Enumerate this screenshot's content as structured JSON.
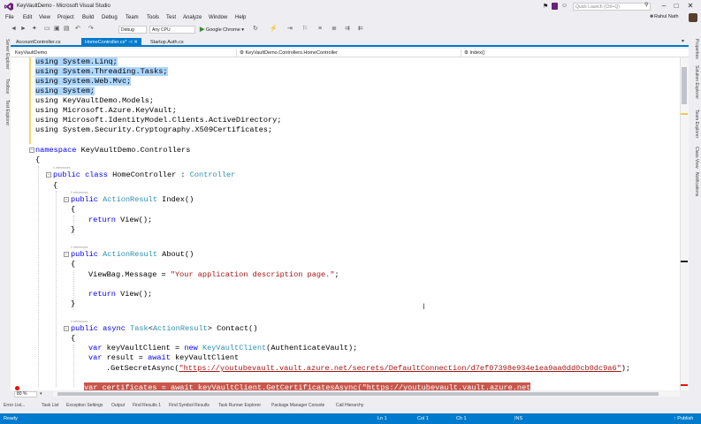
{
  "window": {
    "title": "KeyVaultDemo - Microsoft Visual Studio",
    "quick_launch_placeholder": "Quick Launch (Ctrl+Q)",
    "user_name": "Rahul Nath"
  },
  "menu": [
    "File",
    "Edit",
    "View",
    "Project",
    "Build",
    "Debug",
    "Team",
    "Tools",
    "Test",
    "Analyze",
    "Window",
    "Help"
  ],
  "toolbar": {
    "configuration": "Debug",
    "platform": "Any CPU",
    "run_target": "Google Chrome"
  },
  "left_rail": [
    "Server Explorer",
    "Toolbox",
    "Test Explorer"
  ],
  "right_rail": [
    "Properties",
    "Solution Explorer",
    "Team Explorer",
    "Class View",
    "Notifications"
  ],
  "tabs": [
    {
      "label": "AccountController.cs",
      "active": false
    },
    {
      "label": "HomeController.cs*",
      "active": true
    },
    {
      "label": "Startup.Auth.cs",
      "active": false
    }
  ],
  "navbar": {
    "project": "KeyVaultDemo",
    "class": "KeyVaultDemo.Controllers.HomeController",
    "member": "Index()"
  },
  "code": {
    "using_linq": "using System.Linq;",
    "using_tasks": "using System.Threading.Tasks;",
    "using_mvc": "using System.Web.Mvc;",
    "using_system": "using System;",
    "using_models": "using KeyVaultDemo.Models;",
    "using_keyvault": "using Microsoft.Azure.KeyVault;",
    "using_ad": "using Microsoft.IdentityModel.Clients.ActiveDirectory;",
    "using_x509": "using System.Security.Cryptography.X509Certificates;",
    "ns_kw": "namespace",
    "ns_name": " KeyVaultDemo.Controllers",
    "brace_open": "{",
    "brace_close": "}",
    "references": "0 references",
    "public_kw": "public",
    "class_kw": " class",
    "class_name": " HomeController : ",
    "controller_type": "Controller",
    "action_result": " ActionResult",
    "index_name": " Index()",
    "return_kw": "return",
    "return_view": " View();",
    "about_name": " About()",
    "viewbag": "ViewBag.Message = ",
    "viewbag_str": "\"Your application description page.\"",
    "semicolon": ";",
    "async_kw": " async",
    "task_type": " Task",
    "lt": "<",
    "action_result_generic": "ActionResult",
    "contact_name": "> Contact()",
    "var_kw": "var",
    "kvclient_left": " keyVaultClient = ",
    "new_kw": "new",
    "kvclient_type": " KeyVaultClient",
    "kvclient_args": "(AuthenticateVault);",
    "result_left": " result = ",
    "await_kw": "await",
    "result_right": " keyVaultClient",
    "getsecret": ".GetSecretAsync(",
    "secret_url": "\"https://youtubevault.vault.azure.net/secrets/DefaultConnection/d7ef07398e934e1ea9aa0dd0cb0dc9a6\"",
    "getsecret_end": ");",
    "cert_line": "var certificates = await keyVaultClient.GetCertificatesAsync(\"https://youtubevault.vault.azure.net/\");"
  },
  "zoom": "80 %",
  "bottom_tabs": [
    "Error List...",
    "Task List",
    "Exception Settings",
    "Output",
    "Find Results 1",
    "Find Symbol Results",
    "Task Runner Explorer",
    "Package Manager Console",
    "Call Hierarchy"
  ],
  "status": {
    "state": "Ready",
    "line": "Ln 1",
    "col": "Col 1",
    "ch": "Ch 1",
    "mode": "INS",
    "publish": "↑ Publish"
  },
  "colors": {
    "accent": "#007acc",
    "keyword": "#0000ff",
    "type": "#2b91af",
    "string": "#a31515",
    "selection": "#add6ff",
    "breakpoint": "#c8564b"
  }
}
